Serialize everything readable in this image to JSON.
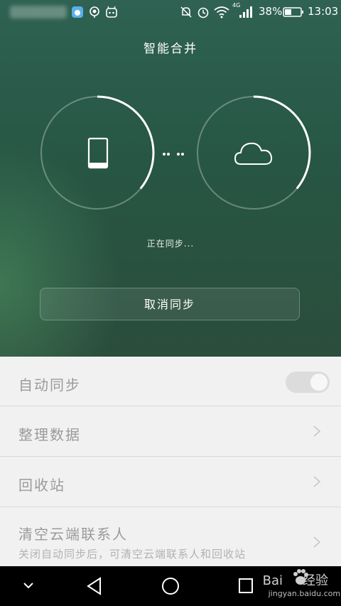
{
  "status_bar": {
    "battery_percent": "38%",
    "time": "13:03",
    "network": "4G",
    "icons": [
      "weibo-icon",
      "hotspot-icon",
      "robot-icon",
      "mute-icon",
      "alarm-icon",
      "wifi-icon",
      "signal-icon",
      "battery-icon"
    ]
  },
  "header": {
    "title": "智能合并"
  },
  "sync": {
    "status_text": "正在同步...",
    "cancel_label": "取消同步",
    "left_progress_fraction": 0.36,
    "right_progress_fraction": 0.36,
    "left_icon": "phone-icon",
    "right_icon": "cloud-icon"
  },
  "settings": {
    "auto_sync": {
      "label": "自动同步",
      "enabled": true
    },
    "organize": {
      "label": "整理数据"
    },
    "recycle": {
      "label": "回收站"
    },
    "clear": {
      "label": "清空云端联系人",
      "sub": "关闭自动同步后，可清空云端联系人和回收站"
    }
  },
  "nav": {
    "icons": [
      "down-chevron-icon",
      "back-icon",
      "home-icon",
      "recents-icon"
    ]
  },
  "watermark": {
    "brand": "Bai",
    "brand_suffix": "经验",
    "url": "jingyan.baidu.com"
  },
  "colors": {
    "hero": "#2b5a48",
    "list_bg": "#f2f1f2",
    "label": "#9a9a9a"
  }
}
